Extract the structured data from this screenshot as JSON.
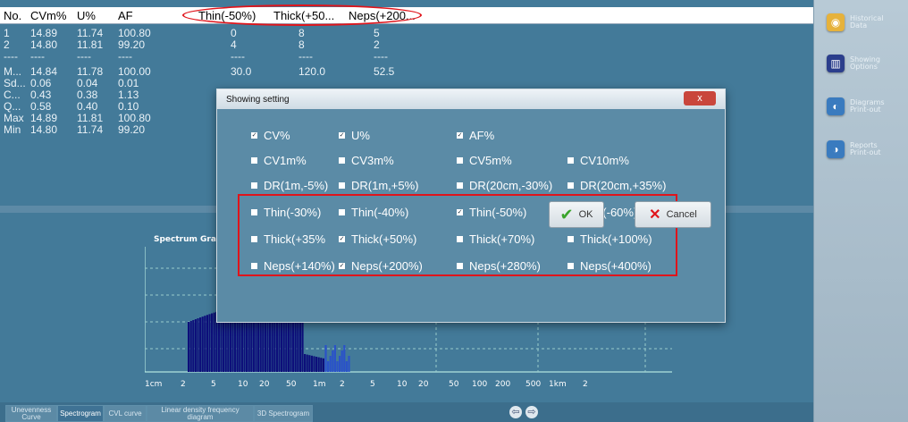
{
  "table": {
    "headers": [
      "No.",
      "CVm%",
      "U%",
      "AF",
      "Thin(-50%)",
      "Thick(+50...",
      "Neps(+200..."
    ],
    "rows": [
      [
        "1",
        "14.89",
        "11.74",
        "100.80",
        "0",
        "8",
        "5"
      ],
      [
        "2",
        "14.80",
        "11.81",
        "99.20",
        "4",
        "8",
        "2"
      ],
      [
        "----",
        "----",
        "----",
        "----",
        "----",
        "----",
        "----"
      ],
      [
        "M...",
        "14.84",
        "11.78",
        "100.00",
        "30.0",
        "120.0",
        "52.5"
      ],
      [
        "Sd...",
        "0.06",
        "0.04",
        "0.01",
        "",
        "",
        ""
      ],
      [
        "C...",
        "0.43",
        "0.38",
        "1.13",
        "",
        "",
        ""
      ],
      [
        "Q...",
        "0.58",
        "0.40",
        "0.10",
        "",
        "",
        ""
      ],
      [
        "Max",
        "14.89",
        "11.81",
        "100.80",
        "",
        "",
        ""
      ],
      [
        "Min",
        "14.80",
        "11.74",
        "99.20",
        "",
        "",
        ""
      ]
    ]
  },
  "sidebar": {
    "items": [
      {
        "line1": "Historical",
        "line2": "Data",
        "icon": "database-icon",
        "color": "#e6b23c"
      },
      {
        "line1": "Showing",
        "line2": "Options",
        "icon": "columns-icon",
        "color": "#2b3e8c"
      },
      {
        "line1": "Diagrams",
        "line2": "Print-out",
        "icon": "diagram-icon",
        "color": "#3a7bbf"
      },
      {
        "line1": "Reports",
        "line2": "Print-out",
        "icon": "report-icon",
        "color": "#3a7bbf"
      }
    ]
  },
  "spectrum": {
    "title": "Spectrum Graph",
    "ticks": [
      "1cm",
      "2",
      "5",
      "10",
      "20",
      "50",
      "1m",
      "2",
      "5",
      "10",
      "20",
      "50",
      "100",
      "200",
      "500",
      "1km",
      "2"
    ]
  },
  "tabs": [
    {
      "label": "Unevenness Curve"
    },
    {
      "label": "Spectrogram"
    },
    {
      "label": "CVL curve"
    },
    {
      "label": "Linear density frequency diagram"
    },
    {
      "label": "3D Spectrogram"
    }
  ],
  "nav": {
    "prev": "⇦",
    "next": "⇨"
  },
  "dialog": {
    "title": "Showing setting",
    "close": "x",
    "options": [
      {
        "label": "CV%",
        "checked": true
      },
      {
        "label": "U%",
        "checked": true
      },
      {
        "label": "AF%",
        "checked": true
      },
      {
        "label": "CV1m%",
        "checked": false
      },
      {
        "label": "CV3m%",
        "checked": false
      },
      {
        "label": "CV5m%",
        "checked": false
      },
      {
        "label": "CV10m%",
        "checked": false
      },
      {
        "label": "DR(1m,-5%)",
        "checked": false
      },
      {
        "label": "DR(1m,+5%)",
        "checked": false
      },
      {
        "label": "DR(20cm,-30%)",
        "checked": false
      },
      {
        "label": "DR(20cm,+35%)",
        "checked": false
      },
      {
        "label": "Thin(-30%)",
        "checked": false
      },
      {
        "label": "Thin(-40%)",
        "checked": false
      },
      {
        "label": "Thin(-50%)",
        "checked": true
      },
      {
        "label": "Thin(-60%)",
        "checked": false
      },
      {
        "label": "Thick(+35%",
        "checked": false
      },
      {
        "label": "Thick(+50%)",
        "checked": true
      },
      {
        "label": "Thick(+70%)",
        "checked": false
      },
      {
        "label": "Thick(+100%)",
        "checked": false
      },
      {
        "label": "Neps(+140%)",
        "checked": false
      },
      {
        "label": "Neps(+200%)",
        "checked": true
      },
      {
        "label": "Neps(+280%)",
        "checked": false
      },
      {
        "label": "Neps(+400%)",
        "checked": false
      }
    ],
    "ok": "OK",
    "cancel": "Cancel"
  },
  "colors": {
    "highlight": "#e0141b",
    "accent_green": "#3aa52c",
    "bar_dark": "#0d0f7a",
    "bar_light": "#2a52c9"
  }
}
